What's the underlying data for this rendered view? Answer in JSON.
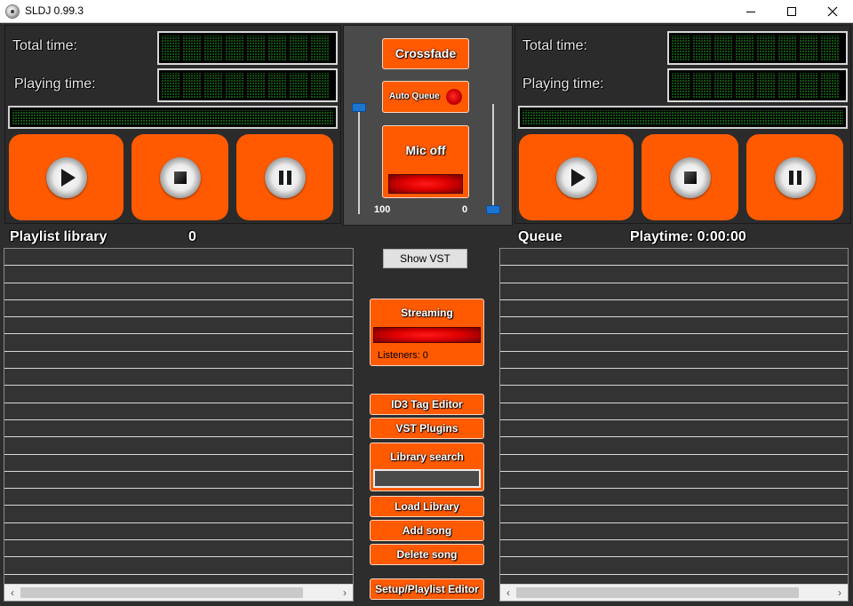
{
  "window": {
    "title": "SLDJ 0.99.3"
  },
  "left_deck": {
    "total_time_label": "Total time:",
    "playing_time_label": "Playing time:"
  },
  "right_deck": {
    "total_time_label": "Total time:",
    "playing_time_label": "Playing time:"
  },
  "mixer": {
    "crossfade_label": "Crossfade",
    "auto_queue_label": "Auto Queue",
    "mic_label": "Mic off",
    "left_volume": "100",
    "right_volume": "0"
  },
  "playlist": {
    "label": "Playlist library",
    "count": "0"
  },
  "queue": {
    "label": "Queue",
    "playtime": "Playtime: 0:00:00"
  },
  "center": {
    "show_vst_label": "Show VST",
    "streaming_label": "Streaming",
    "listeners": "Listeners: 0",
    "id3_label": "ID3 Tag Editor",
    "vst_plugins_label": "VST Plugins",
    "library_search_label": "Library search",
    "library_search_value": "",
    "load_library_label": "Load Library",
    "add_song_label": "Add song",
    "delete_song_label": "Delete song",
    "setup_label": "Setup/Playlist Editor"
  },
  "colors": {
    "accent": "#ff5a00",
    "background": "#2d2d2d",
    "lcd_green": "#135813",
    "slider_thumb": "#1c74d0"
  }
}
